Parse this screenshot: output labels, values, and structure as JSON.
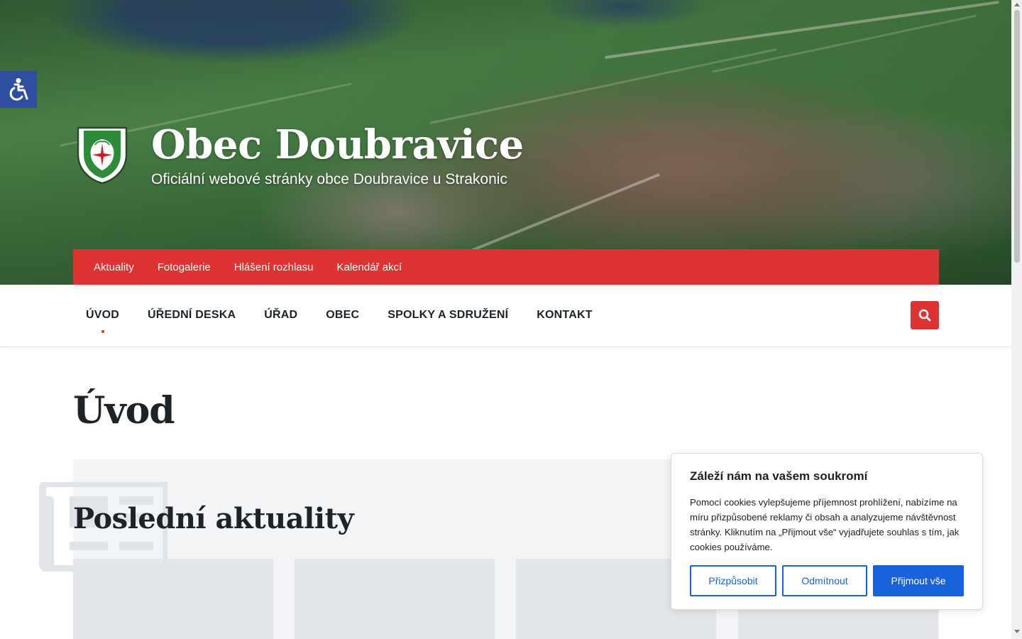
{
  "site": {
    "title": "Obec Doubravice",
    "tagline": "Oficiální webové stránky obce Doubravice u Strakonic"
  },
  "topbar": {
    "links": [
      "Aktuality",
      "Fotogalerie",
      "Hlášení rozhlasu",
      "Kalendář akcí"
    ]
  },
  "nav": {
    "items": [
      "ÚVOD",
      "ÚŘEDNÍ DESKA",
      "ÚŘAD",
      "OBEC",
      "SPOLKY A SDRUŽENÍ",
      "KONTAKT"
    ],
    "active": "ÚVOD"
  },
  "page": {
    "title": "Úvod",
    "news_heading": "Poslední aktuality"
  },
  "cookie": {
    "title": "Záleží nám na vašem soukromí",
    "text": "Pomocí cookies vylepšujeme příjemnost prohlížení, nabízíme na míru přizpůsobené reklamy či obsah a analyzujeme návštěvnost stránky. Kliknutím na „Přijmout vše“ vyjadřujete souhlas s tím, jak cookies používáme.",
    "customize_label": "Přizpůsobit",
    "reject_label": "Odmítnout",
    "accept_label": "Přijmout vše"
  },
  "icons": {
    "accessibility": "accessibility-icon",
    "search": "search-icon",
    "coat_of_arms": "coat-of-arms-logo",
    "news": "news-icon"
  },
  "colors": {
    "accent_red": "#dd3333",
    "cookie_blue": "#1863dc",
    "accessibility_blue": "#2e4e9f",
    "section_bg": "#f2f4f6"
  }
}
